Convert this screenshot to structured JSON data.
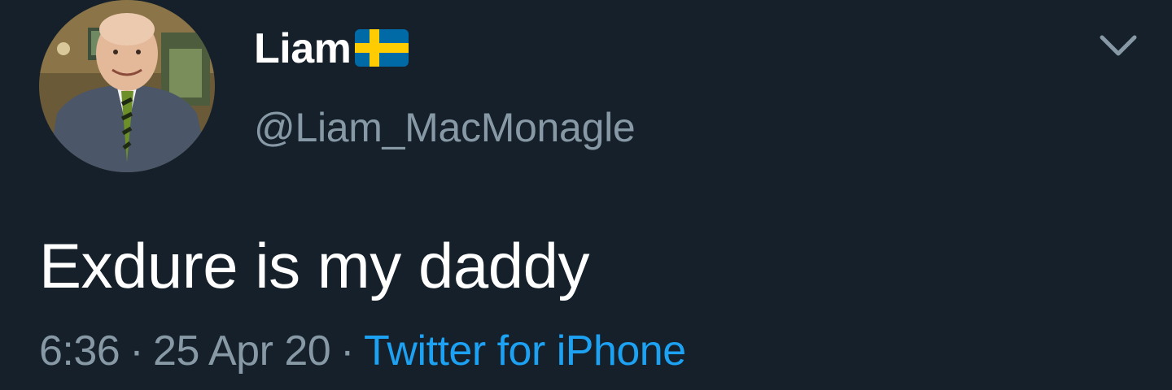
{
  "tweet": {
    "author": {
      "display_name": "Liam",
      "handle": "@Liam_MacMonagle",
      "flag_icon": "sweden-flag-icon",
      "avatar": "profile-avatar"
    },
    "text": "Exdure is my daddy",
    "time": "6:36",
    "date": "25 Apr 20",
    "separator": "·",
    "source": "Twitter for iPhone",
    "menu_icon": "chevron-down-icon"
  },
  "colors": {
    "background": "#15202b",
    "primary_text": "#ffffff",
    "secondary_text": "#8899a6",
    "link": "#1da1f2",
    "flag_blue": "#006aa7",
    "flag_yellow": "#fecc00"
  }
}
